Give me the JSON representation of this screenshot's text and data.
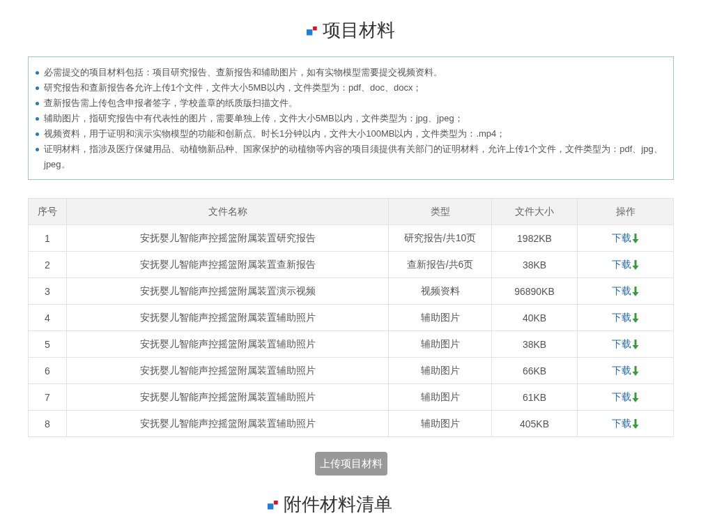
{
  "section_title": "项目材料",
  "notes": [
    "必需提交的项目材料包括：项目研究报告、查新报告和辅助图片，如有实物模型需要提交视频资料。",
    "研究报告和查新报告各允许上传1个文件，文件大小5MB以内，文件类型为：pdf、doc、docx；",
    "查新报告需上传包含申报者签字，学校盖章的纸质版扫描文件。",
    "辅助图片，指研究报告中有代表性的图片，需要单独上传，文件大小5MB以内，文件类型为：jpg、jpeg；",
    "视频资料，用于证明和演示实物模型的功能和创新点。时长1分钟以内，文件大小100MB以内，文件类型为：.mp4；",
    "证明材料，指涉及医疗保健用品、动植物新品种、国家保护的动植物等内容的项目须提供有关部门的证明材料，允许上传1个文件，文件类型为：pdf、jpg、jpeg。"
  ],
  "table": {
    "columns": [
      "序号",
      "文件名称",
      "类型",
      "文件大小",
      "操作"
    ],
    "rows": [
      {
        "index": "1",
        "name": "安抚婴儿智能声控摇篮附属装置研究报告",
        "type": "研究报告/共10页",
        "size": "1982KB",
        "action": "下载"
      },
      {
        "index": "2",
        "name": "安抚婴儿智能声控摇篮附属装置查新报告",
        "type": "查新报告/共6页",
        "size": "38KB",
        "action": "下载"
      },
      {
        "index": "3",
        "name": "安抚婴儿智能声控摇篮附属装置演示视频",
        "type": "视频资料",
        "size": "96890KB",
        "action": "下载"
      },
      {
        "index": "4",
        "name": "安抚婴儿智能声控摇篮附属装置辅助照片",
        "type": "辅助图片",
        "size": "40KB",
        "action": "下载"
      },
      {
        "index": "5",
        "name": "安抚婴儿智能声控摇篮附属装置辅助照片",
        "type": "辅助图片",
        "size": "38KB",
        "action": "下载"
      },
      {
        "index": "6",
        "name": "安抚婴儿智能声控摇篮附属装置辅助照片",
        "type": "辅助图片",
        "size": "66KB",
        "action": "下载"
      },
      {
        "index": "7",
        "name": "安抚婴儿智能声控摇篮附属装置辅助照片",
        "type": "辅助图片",
        "size": "61KB",
        "action": "下载"
      },
      {
        "index": "8",
        "name": "安抚婴儿智能声控摇篮附属装置辅助照片",
        "type": "辅助图片",
        "size": "405KB",
        "action": "下载"
      }
    ]
  },
  "upload_button": "上传项目材料",
  "next_section_title": "附件材料清单"
}
